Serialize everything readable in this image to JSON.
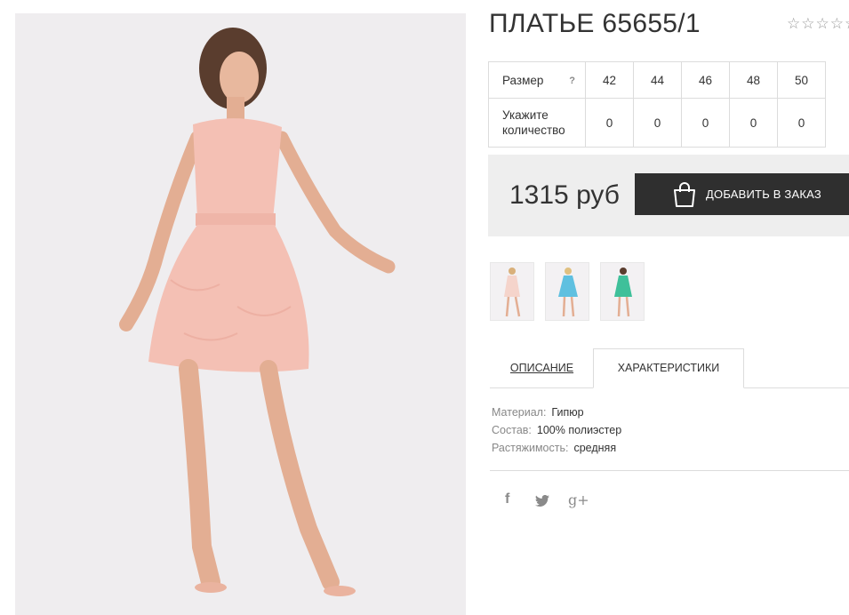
{
  "product": {
    "title": "ПЛАТЬЕ 65655/1",
    "rating_stars": "☆☆☆☆☆"
  },
  "size_table": {
    "size_label": "Размер",
    "help_mark": "?",
    "sizes": [
      "42",
      "44",
      "46",
      "48",
      "50"
    ],
    "qty_label": "Укажите количество",
    "quantities": [
      "0",
      "0",
      "0",
      "0",
      "0"
    ]
  },
  "buy": {
    "price": "1315 руб",
    "add_button_label": "ДОБАВИТЬ В ЗАКАЗ"
  },
  "tabs": {
    "description": "ОПИСАНИЕ",
    "characteristics": "ХАРАКТЕРИСТИКИ",
    "active": "characteristics"
  },
  "specs": [
    {
      "key": "Материал:",
      "value": "Гипюр"
    },
    {
      "key": "Состав:",
      "value": "100% полиэстер"
    },
    {
      "key": "Растяжимость:",
      "value": "средняя"
    }
  ],
  "social": {
    "facebook": "f",
    "twitter": "twitter-icon",
    "googleplus": "g+"
  },
  "colors": {
    "dress_pink": "#f4c0b4",
    "thumb_blue": "#5fc0e0",
    "thumb_green": "#3fc09a",
    "button_dark": "#2f2f2f",
    "buybox_bg": "#eeeeee"
  }
}
